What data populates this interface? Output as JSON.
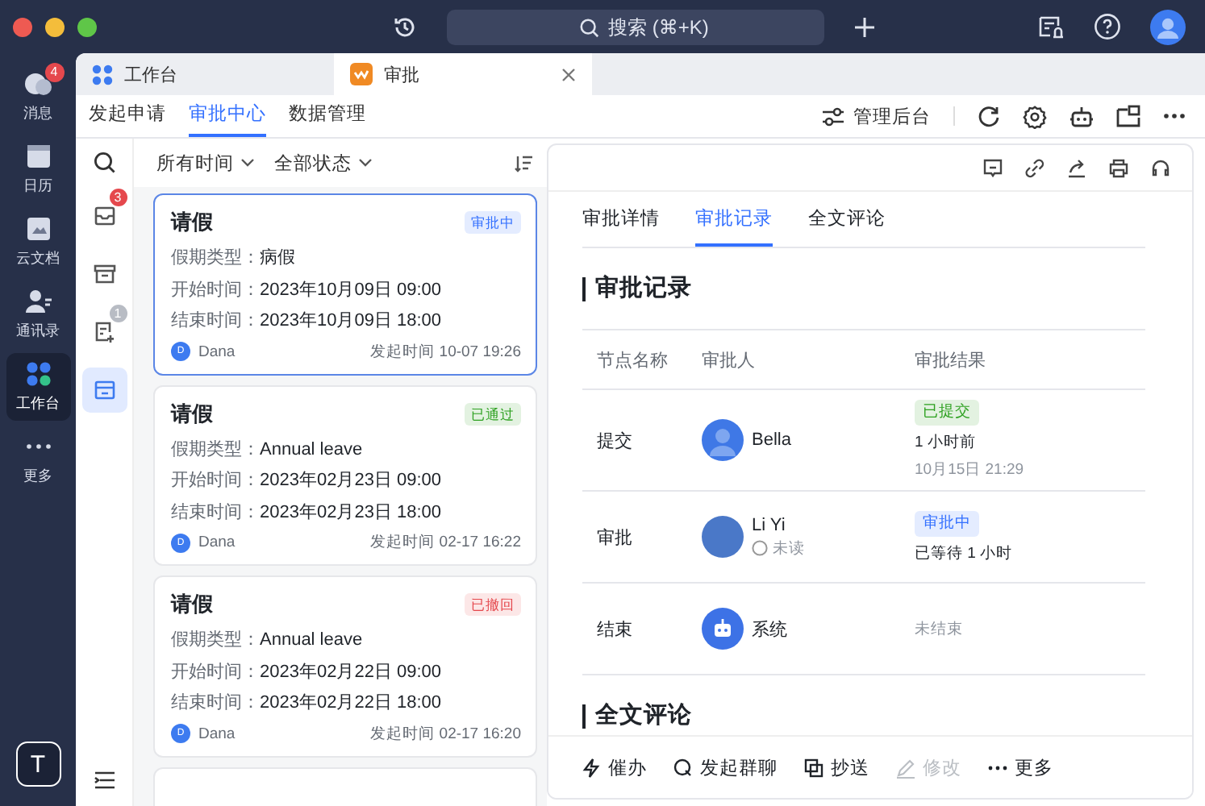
{
  "topbar": {
    "search": {
      "placeholder": "搜索 (⌘+K)"
    }
  },
  "rail": {
    "items": [
      {
        "label": "消息",
        "badge": "4",
        "selected": false
      },
      {
        "label": "日历",
        "selected": false
      },
      {
        "label": "云文档",
        "selected": false
      },
      {
        "label": "通讯录",
        "selected": false
      },
      {
        "label": "工作台",
        "selected": true
      },
      {
        "label": "更多",
        "selected": false
      }
    ],
    "user": "T"
  },
  "tabs": [
    {
      "label": "工作台",
      "selected": false
    },
    {
      "label": "审批",
      "selected": true
    }
  ],
  "nav": {
    "items": [
      {
        "label": "发起申请",
        "selected": false
      },
      {
        "label": "审批中心",
        "selected": true
      },
      {
        "label": "数据管理",
        "selected": false
      }
    ],
    "admin": "管理后台"
  },
  "filters": [
    "所有时间",
    "全部状态"
  ],
  "side_icons": [
    {
      "badge": "3",
      "color": "#e5484d",
      "selected": false
    },
    {
      "selected": false
    },
    {
      "badge": "1",
      "color": "#b8bcc4",
      "selected": false
    },
    {
      "selected": true
    }
  ],
  "cards": [
    {
      "title": "请假",
      "status": {
        "text": "审批中",
        "color": "#3370ff"
      },
      "selected": true,
      "fields": [
        {
          "label": "假期类型：",
          "value": "病假"
        },
        {
          "label": "开始时间：",
          "value": "2023年10月09日 09:00"
        },
        {
          "label": "结束时间：",
          "value": "2023年10月09日 18:00"
        }
      ],
      "avatar": "D",
      "author": "Dana",
      "time": "发起时间 10-07 19:26"
    },
    {
      "title": "请假",
      "status": {
        "text": "已通过",
        "color": "#2ea121"
      },
      "selected": false,
      "fields": [
        {
          "label": "假期类型：",
          "value": "Annual leave"
        },
        {
          "label": "开始时间：",
          "value": "2023年02月23日 09:00"
        },
        {
          "label": "结束时间：",
          "value": "2023年02月23日 18:00"
        }
      ],
      "avatar": "D",
      "author": "Dana",
      "time": "发起时间 02-17 16:22"
    },
    {
      "title": "请假",
      "status": {
        "text": "已撤回",
        "color": "#e5484d"
      },
      "selected": false,
      "fields": [
        {
          "label": "假期类型：",
          "value": "Annual leave"
        },
        {
          "label": "开始时间：",
          "value": "2023年02月22日 09:00"
        },
        {
          "label": "结束时间：",
          "value": "2023年02月22日 18:00"
        }
      ],
      "avatar": "D",
      "author": "Dana",
      "time": "发起时间 02-17 16:20"
    }
  ],
  "detail": {
    "tabs": [
      {
        "label": "审批详情",
        "selected": false
      },
      {
        "label": "审批记录",
        "selected": true
      },
      {
        "label": "全文评论",
        "selected": false
      }
    ],
    "section_title": "审批记录",
    "columns": [
      "节点名称",
      "审批人",
      "审批结果"
    ],
    "rows": [
      {
        "node": "提交",
        "person": "Bella",
        "status": {
          "text": "已提交",
          "color": "#2ea121"
        },
        "lines": [
          {
            "text": "1 小时前",
            "muted": false
          },
          {
            "text": "10月15日 21:29",
            "muted": true
          }
        ]
      },
      {
        "node": "审批",
        "person": "Li Yi",
        "read_state": "未读",
        "status": {
          "text": "审批中",
          "color": "#3370ff"
        },
        "lines": [
          {
            "text": "已等待 1 小时",
            "muted": false
          }
        ]
      },
      {
        "node": "结束",
        "person": "系统",
        "lines": [
          {
            "text": "未结束",
            "muted": true
          }
        ]
      }
    ],
    "comment_title": "全文评论",
    "actions": [
      {
        "label": "催办",
        "kind": "bolt",
        "disabled": false
      },
      {
        "label": "发起群聊",
        "kind": "chat",
        "disabled": false
      },
      {
        "label": "抄送",
        "kind": "copy",
        "disabled": false
      },
      {
        "label": "修改",
        "kind": "edit",
        "disabled": true
      },
      {
        "label": "更多",
        "kind": "more",
        "disabled": false
      }
    ]
  }
}
